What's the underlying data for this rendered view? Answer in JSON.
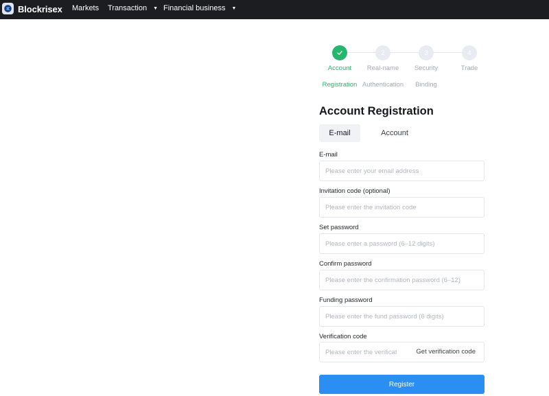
{
  "header": {
    "brand": "Blockrisex",
    "nav": {
      "markets": "Markets",
      "transaction": "Transaction",
      "financial": "Financial business"
    }
  },
  "steps": [
    {
      "number": "",
      "line1": "Account",
      "line2": "Registration",
      "state": "done"
    },
    {
      "number": "2",
      "line1": "Real-name",
      "line2": "Authentication",
      "state": "pending"
    },
    {
      "number": "3",
      "line1": "Security",
      "line2": "Binding",
      "state": "pending"
    },
    {
      "number": "4",
      "line1": "Trade",
      "line2": "",
      "state": "pending"
    }
  ],
  "form": {
    "title": "Account Registration",
    "tabs": {
      "email": "E-mail",
      "account": "Account"
    },
    "email": {
      "label": "E-mail",
      "placeholder": "Please enter your email address"
    },
    "invite": {
      "label": "Invitation code (optional)",
      "placeholder": "Please enter the invitation code"
    },
    "password": {
      "label": "Set password",
      "placeholder": "Please enter a password (6–12 digits)"
    },
    "confirm": {
      "label": "Confirm password",
      "placeholder": "Please enter the confirmation password (6–12)"
    },
    "funding": {
      "label": "Funding password",
      "placeholder": "Please enter the fund password (6 digits)"
    },
    "verification": {
      "label": "Verification code",
      "placeholder": "Please enter the verificatic",
      "get_code": "Get verification code"
    },
    "register": "Register"
  },
  "colors": {
    "accent": "#2a8ef2",
    "success": "#27b66e",
    "topbar": "#1b1d21"
  }
}
